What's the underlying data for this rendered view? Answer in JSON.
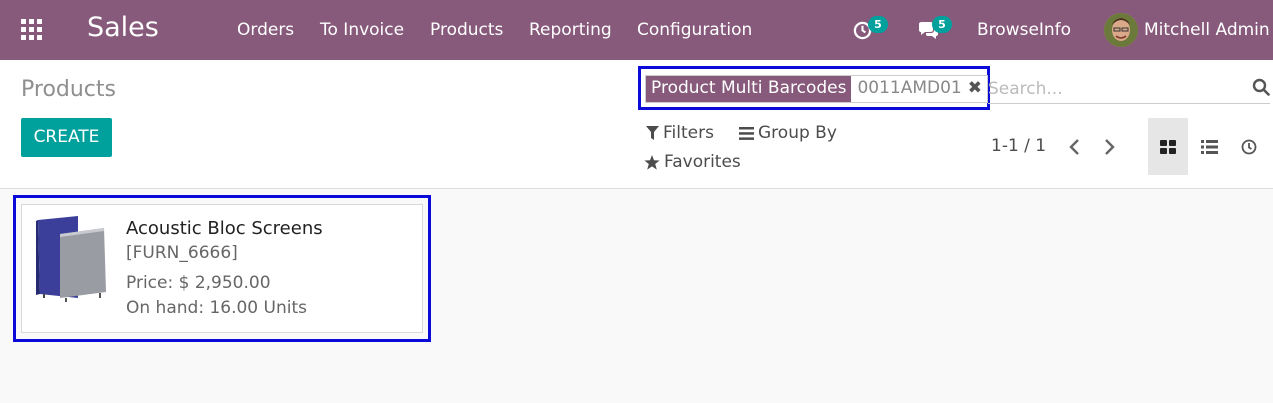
{
  "navbar": {
    "app_name": "Sales",
    "menu": [
      {
        "label": "Orders"
      },
      {
        "label": "To Invoice"
      },
      {
        "label": "Products"
      },
      {
        "label": "Reporting"
      },
      {
        "label": "Configuration"
      }
    ],
    "activity_count": "5",
    "messages_count": "5",
    "company": "BrowseInfo",
    "user": "Mitchell Admin"
  },
  "control_panel": {
    "title": "Products",
    "create_label": "CREATE",
    "search": {
      "facet_label": "Product Multi Barcodes",
      "facet_value": "0011AMD01",
      "facet_remove": "✖",
      "placeholder": "Search..."
    },
    "filters_label": "Filters",
    "group_by_label": "Group By",
    "favorites_label": "Favorites",
    "pager": "1-1 / 1",
    "views": [
      "kanban-icon",
      "list-icon",
      "activity-icon"
    ],
    "active_view": "kanban"
  },
  "kanban": {
    "records": [
      {
        "name": "Acoustic Bloc Screens",
        "ref": "[FURN_6666]",
        "price": "Price: $ 2,950.00",
        "on_hand": "On hand: 16.00 Units"
      }
    ]
  },
  "colors": {
    "brand": "#875a7b",
    "accent": "#00a09d",
    "highlight": "#0b0bd9"
  }
}
